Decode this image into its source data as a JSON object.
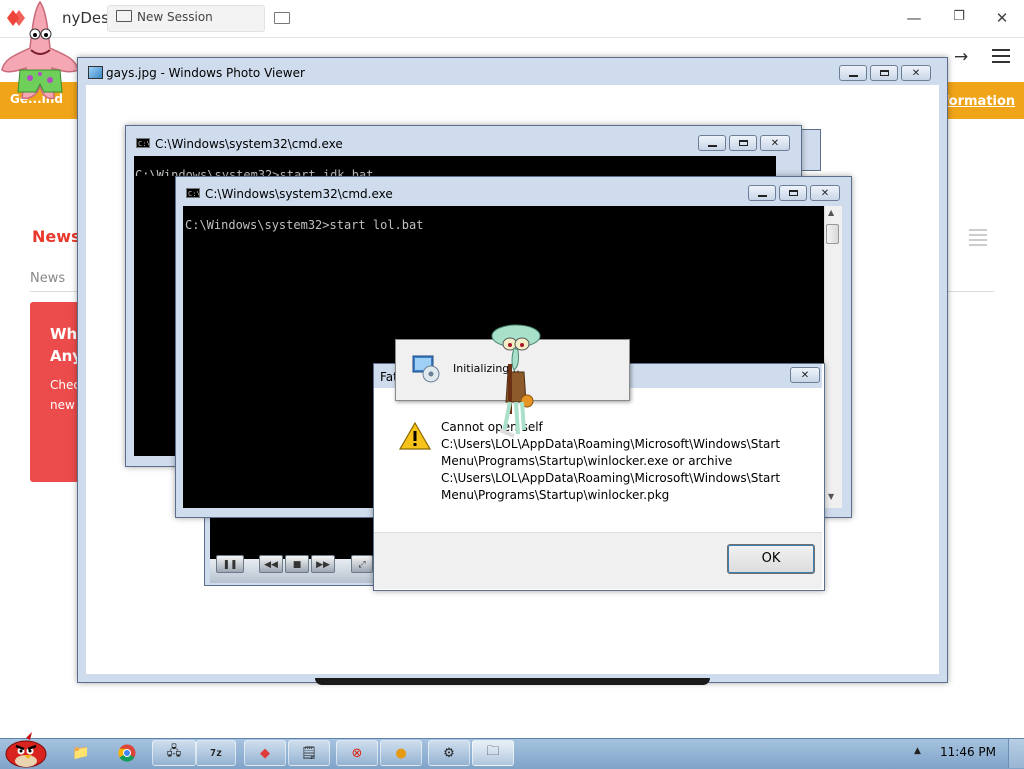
{
  "anydesk": {
    "app_name": "AnyDesk",
    "app_name_visible": "nyDesk",
    "tab_label": "New Session",
    "address_text": "",
    "banner_left": "Ge...ind",
    "banner_link": "formation",
    "news_title": "News",
    "news_tab": "News",
    "card_title_line1": "Wh",
    "card_title_line2": "Any",
    "card_text_line1": "Chec",
    "card_text_line2": "new",
    "colors": {
      "brand": "#ef443b",
      "banner": "#f0a519",
      "card": "#ec4b4b"
    }
  },
  "photo_viewer": {
    "title": "gays.jpg - Windows Photo Viewer"
  },
  "cmd_back": {
    "title": "C:\\Windows\\system32\\cmd.exe",
    "line": "C:\\Windows\\system32>start idk.bat"
  },
  "cmd_front": {
    "title": "C:\\Windows\\system32\\cmd.exe",
    "line": "C:\\Windows\\system32>start lol.bat"
  },
  "fatal_error": {
    "title": "Fat",
    "message": "Cannot open self\nC:\\Users\\LOL\\AppData\\Roaming\\Microsoft\\Windows\\Start\nMenu\\Programs\\Startup\\winlocker.exe or archive\nC:\\Users\\LOL\\AppData\\Roaming\\Microsoft\\Windows\\Start\nMenu\\Programs\\Startup\\winlocker.pkg",
    "ok_label": "OK"
  },
  "initializing": {
    "text": "Initializing..."
  },
  "cmd_icon_text": "C:\\",
  "window_buttons": {
    "close_glyph": "✕"
  },
  "taskbar": {
    "clock": "11:46 PM",
    "items": [
      "start-orb",
      "explorer-folder",
      "chrome",
      "network",
      "7zip",
      "anydesk",
      "notepad",
      "error-app",
      "media-app",
      "tool-app",
      "folder-app"
    ],
    "active_item": "folder-app"
  }
}
